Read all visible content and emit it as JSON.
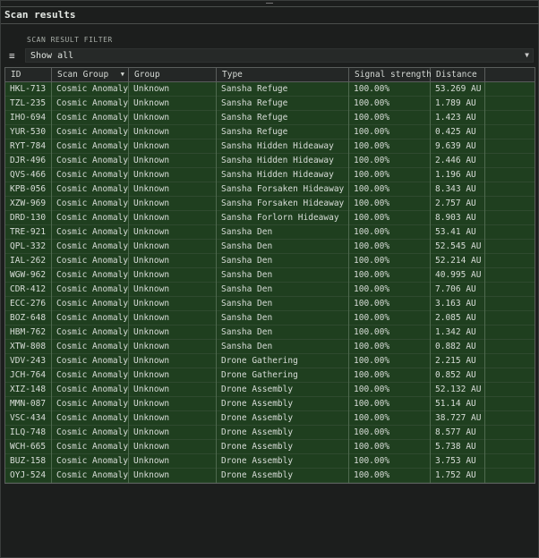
{
  "window": {
    "title": "Scan results"
  },
  "filter": {
    "label": "SCAN RESULT FILTER",
    "value": "Show all",
    "menu_icon": "hamburger-icon",
    "dropdown_icon": "chevron-down-icon"
  },
  "table": {
    "columns": [
      "ID",
      "Scan Group",
      "Group",
      "Type",
      "Signal strength",
      "Distance"
    ],
    "sorted_column": "Scan Group",
    "rows": [
      [
        "HKL-713",
        "Cosmic Anomaly",
        "Unknown",
        "Sansha Refuge",
        "100.00%",
        "53.269 AU"
      ],
      [
        "TZL-235",
        "Cosmic Anomaly",
        "Unknown",
        "Sansha Refuge",
        "100.00%",
        "1.789 AU"
      ],
      [
        "IHO-694",
        "Cosmic Anomaly",
        "Unknown",
        "Sansha Refuge",
        "100.00%",
        "1.423 AU"
      ],
      [
        "YUR-530",
        "Cosmic Anomaly",
        "Unknown",
        "Sansha Refuge",
        "100.00%",
        "0.425 AU"
      ],
      [
        "RYT-784",
        "Cosmic Anomaly",
        "Unknown",
        "Sansha Hidden Hideaway",
        "100.00%",
        "9.639 AU"
      ],
      [
        "DJR-496",
        "Cosmic Anomaly",
        "Unknown",
        "Sansha Hidden Hideaway",
        "100.00%",
        "2.446 AU"
      ],
      [
        "QVS-466",
        "Cosmic Anomaly",
        "Unknown",
        "Sansha Hidden Hideaway",
        "100.00%",
        "1.196 AU"
      ],
      [
        "KPB-056",
        "Cosmic Anomaly",
        "Unknown",
        "Sansha Forsaken Hideaway",
        "100.00%",
        "8.343 AU"
      ],
      [
        "XZW-969",
        "Cosmic Anomaly",
        "Unknown",
        "Sansha Forsaken Hideaway",
        "100.00%",
        "2.757 AU"
      ],
      [
        "DRD-130",
        "Cosmic Anomaly",
        "Unknown",
        "Sansha Forlorn Hideaway",
        "100.00%",
        "8.903 AU"
      ],
      [
        "TRE-921",
        "Cosmic Anomaly",
        "Unknown",
        "Sansha Den",
        "100.00%",
        "53.41 AU"
      ],
      [
        "QPL-332",
        "Cosmic Anomaly",
        "Unknown",
        "Sansha Den",
        "100.00%",
        "52.545 AU"
      ],
      [
        "IAL-262",
        "Cosmic Anomaly",
        "Unknown",
        "Sansha Den",
        "100.00%",
        "52.214 AU"
      ],
      [
        "WGW-962",
        "Cosmic Anomaly",
        "Unknown",
        "Sansha Den",
        "100.00%",
        "40.995 AU"
      ],
      [
        "CDR-412",
        "Cosmic Anomaly",
        "Unknown",
        "Sansha Den",
        "100.00%",
        "7.706 AU"
      ],
      [
        "ECC-276",
        "Cosmic Anomaly",
        "Unknown",
        "Sansha Den",
        "100.00%",
        "3.163 AU"
      ],
      [
        "BOZ-648",
        "Cosmic Anomaly",
        "Unknown",
        "Sansha Den",
        "100.00%",
        "2.085 AU"
      ],
      [
        "HBM-762",
        "Cosmic Anomaly",
        "Unknown",
        "Sansha Den",
        "100.00%",
        "1.342 AU"
      ],
      [
        "XTW-808",
        "Cosmic Anomaly",
        "Unknown",
        "Sansha Den",
        "100.00%",
        "0.882 AU"
      ],
      [
        "VDV-243",
        "Cosmic Anomaly",
        "Unknown",
        "Drone Gathering",
        "100.00%",
        "2.215 AU"
      ],
      [
        "JCH-764",
        "Cosmic Anomaly",
        "Unknown",
        "Drone Gathering",
        "100.00%",
        "0.852 AU"
      ],
      [
        "XIZ-148",
        "Cosmic Anomaly",
        "Unknown",
        "Drone Assembly",
        "100.00%",
        "52.132 AU"
      ],
      [
        "MMN-087",
        "Cosmic Anomaly",
        "Unknown",
        "Drone Assembly",
        "100.00%",
        "51.14 AU"
      ],
      [
        "VSC-434",
        "Cosmic Anomaly",
        "Unknown",
        "Drone Assembly",
        "100.00%",
        "38.727 AU"
      ],
      [
        "ILQ-748",
        "Cosmic Anomaly",
        "Unknown",
        "Drone Assembly",
        "100.00%",
        "8.577 AU"
      ],
      [
        "WCH-665",
        "Cosmic Anomaly",
        "Unknown",
        "Drone Assembly",
        "100.00%",
        "5.738 AU"
      ],
      [
        "BUZ-158",
        "Cosmic Anomaly",
        "Unknown",
        "Drone Assembly",
        "100.00%",
        "3.753 AU"
      ],
      [
        "OYJ-524",
        "Cosmic Anomaly",
        "Unknown",
        "Drone Assembly",
        "100.00%",
        "1.752 AU"
      ]
    ]
  },
  "colors": {
    "row_bg": "#1f3f1f",
    "window_bg": "#1c1e1d"
  }
}
